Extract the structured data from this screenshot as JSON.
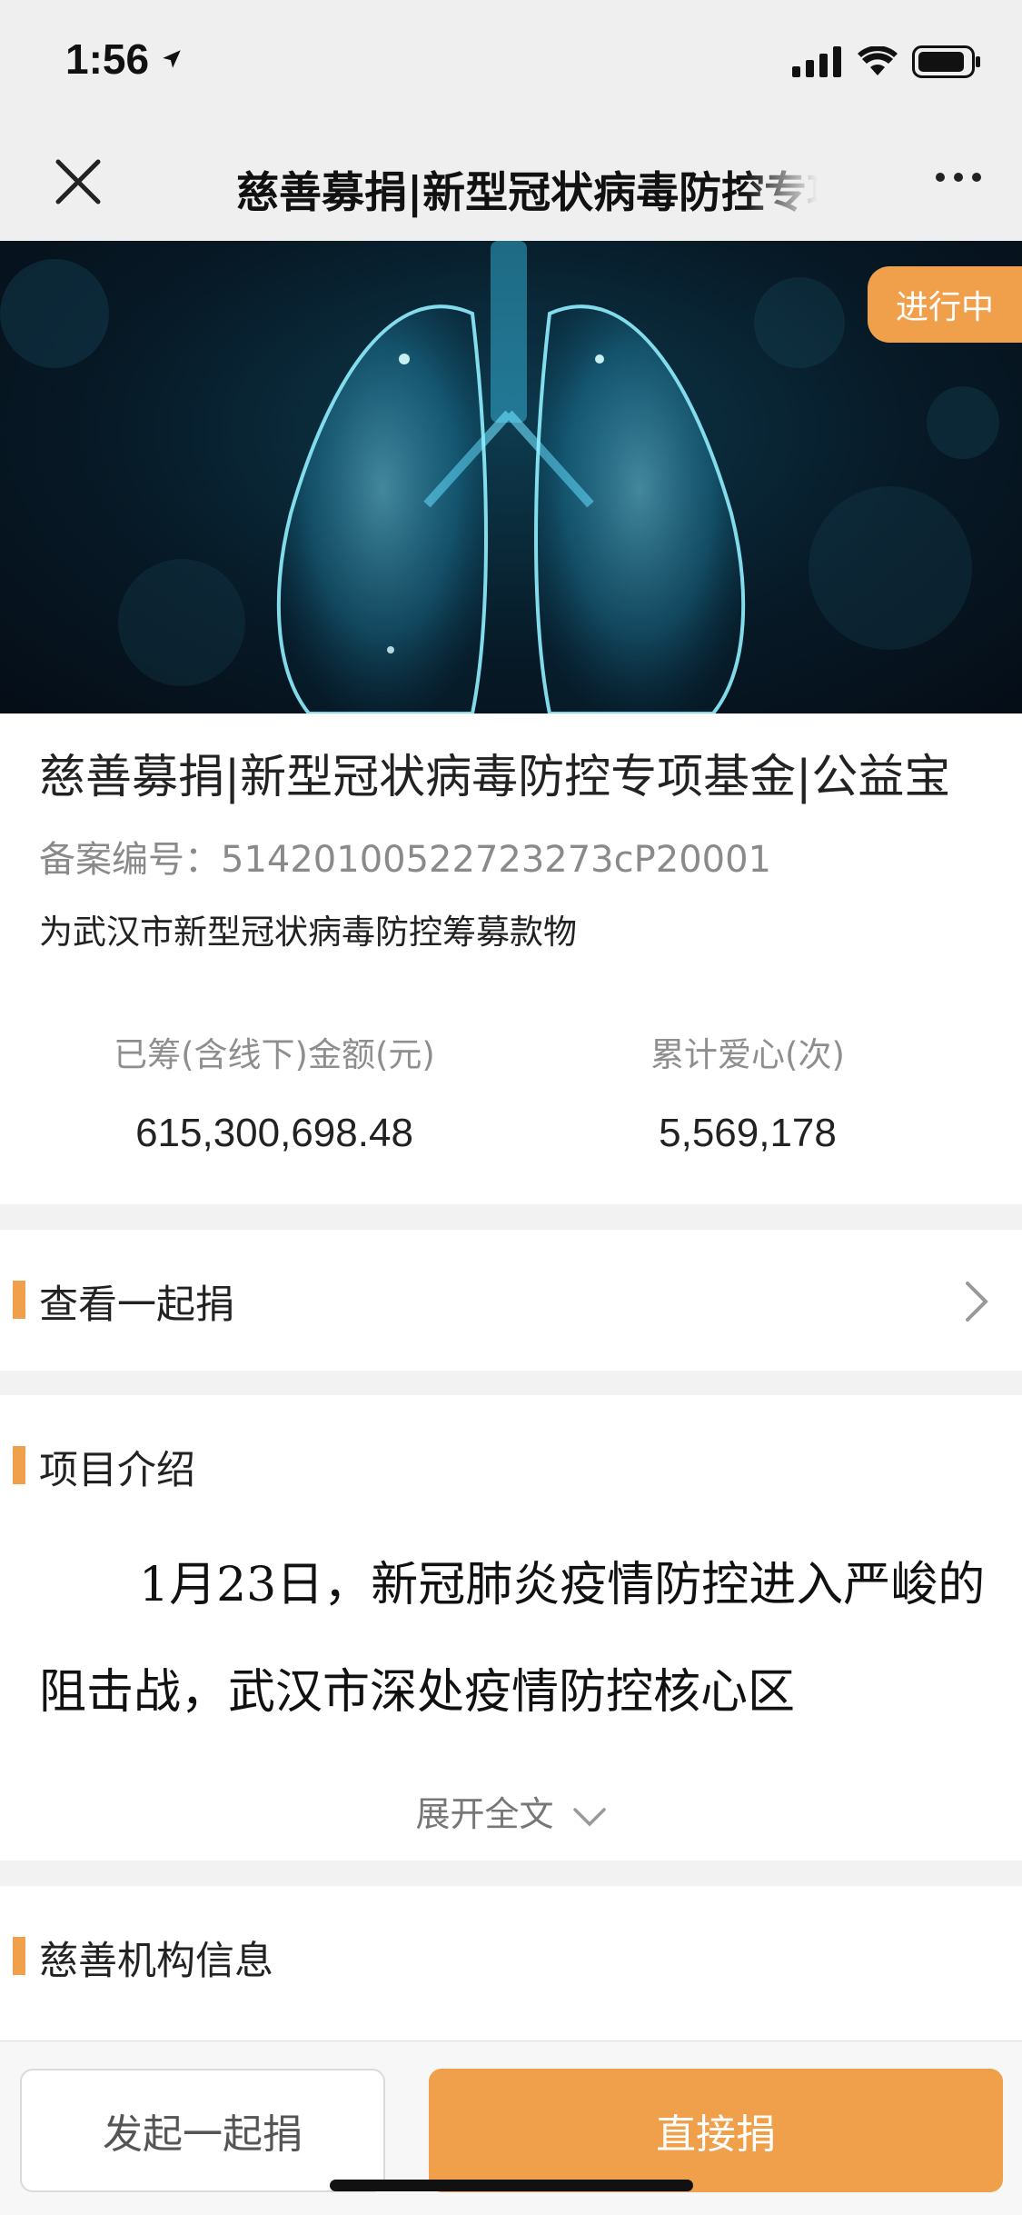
{
  "status_bar": {
    "time": "1:56"
  },
  "nav": {
    "title": "慈善募捐|新型冠状病毒防控专项基金|公益宝"
  },
  "hero": {
    "badge": "进行中"
  },
  "project": {
    "title": "慈善募捐|新型冠状病毒防控专项基金|公益宝",
    "registration": "备案编号：51420100522723273cP20001",
    "description": "为武汉市新型冠状病毒防控筹募款物",
    "stats": [
      {
        "label": "已筹(含线下)金额(元)",
        "value": "615,300,698.48"
      },
      {
        "label": "累计爱心(次)",
        "value": "5,569,178"
      }
    ]
  },
  "sections": {
    "group_donate": "查看一起捐",
    "intro": {
      "title": "项目介绍",
      "text": "1月23日，新冠肺炎疫情防控进入严峻的阻击战，武汉市深处疫情防控核心区",
      "expand": "展开全文"
    },
    "org": "慈善机构信息"
  },
  "bottom": {
    "start_group": "发起一起捐",
    "donate": "直接捐"
  },
  "colors": {
    "accent": "#f0a04b",
    "nav_bg": "#efefef"
  }
}
